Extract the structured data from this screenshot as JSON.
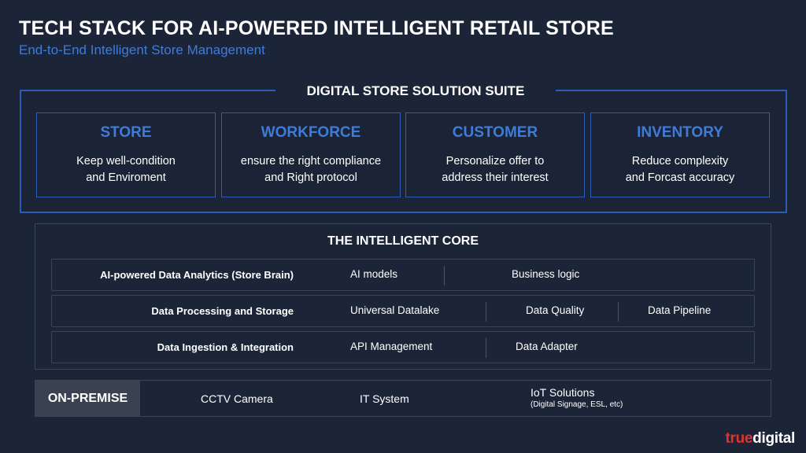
{
  "header": {
    "title": "TECH STACK FOR AI-POWERED INTELLIGENT RETAIL STORE",
    "subtitle": "End-to-End Intelligent Store Management"
  },
  "suite": {
    "title": "DIGITAL STORE SOLUTION SUITE",
    "cards": [
      {
        "title": "STORE",
        "line1": "Keep well-condition",
        "line2": "and Enviroment"
      },
      {
        "title": "WORKFORCE",
        "line1": "ensure the right compliance",
        "line2": "and Right protocol"
      },
      {
        "title": "CUSTOMER",
        "line1": "Personalize offer to",
        "line2": "address their interest"
      },
      {
        "title": "INVENTORY",
        "line1": "Reduce complexity",
        "line2": "and Forcast accuracy"
      }
    ]
  },
  "core": {
    "title": "THE INTELLIGENT CORE",
    "rows": [
      {
        "label": "AI-powered Data Analytics (Store Brain)",
        "items": [
          "AI models",
          "Business logic"
        ]
      },
      {
        "label": "Data Processing and Storage",
        "items": [
          "Universal Datalake",
          "Data Quality",
          "Data Pipeline"
        ]
      },
      {
        "label": "Data Ingestion & Integration",
        "items": [
          "API Management",
          "Data Adapter"
        ]
      }
    ]
  },
  "onprem": {
    "label": "ON-PREMISE",
    "items": [
      "CCTV Camera",
      "IT System",
      "IoT Solutions"
    ],
    "iot_note": "(Digital Signage, ESL, etc)"
  },
  "logo": {
    "part1": "true",
    "part2": "digital",
    "brand_red": "#e2322f"
  },
  "colors": {
    "background": "#1c2538",
    "accent_blue": "#3f7bd9",
    "border_blue": "#2e5bb4"
  }
}
